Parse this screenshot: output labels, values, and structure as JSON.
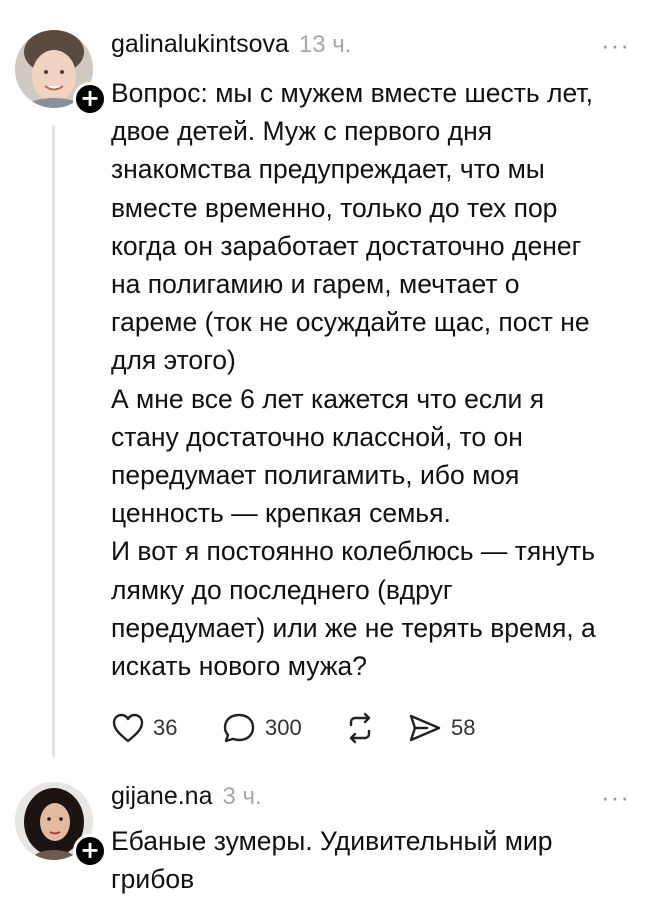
{
  "posts": [
    {
      "username": "galinalukintsova",
      "time": "13 ч.",
      "more": "···",
      "follow_symbol": "+",
      "text": "Вопрос: мы с мужем вместе шесть лет,\nдвое детей. Муж с первого дня\nзнакомства предупреждает, что мы\nвместе временно, только до тех пор\nкогда он заработает достаточно денег\nна полигамию и гарем, мечтает о\nгареме (ток не осуждайте щас, пост не\nдля этого)\nА мне все 6 лет кажется что если я\nстану достаточно классной, то он\nпередумает полигамить, ибо моя\nценность — крепкая семья.\nИ вот я постоянно колеблюсь — тянуть\nлямку до последнего (вдруг\nпередумает) или же не терять время, а\nискать нового мужа?",
      "actions": {
        "likes": "36",
        "replies": "300",
        "reposts": "",
        "shares": "58"
      }
    },
    {
      "username": "gijane.na",
      "time": "3 ч.",
      "more": "···",
      "follow_symbol": "+",
      "text": "Ебаные зумеры. Удивительный мир\nгрибов"
    }
  ],
  "icons": {
    "like": "heart-icon",
    "reply": "speech-bubble-icon",
    "repost": "repost-arrows-icon",
    "share": "send-icon",
    "more": "more-dots-icon",
    "follow": "plus-icon"
  }
}
